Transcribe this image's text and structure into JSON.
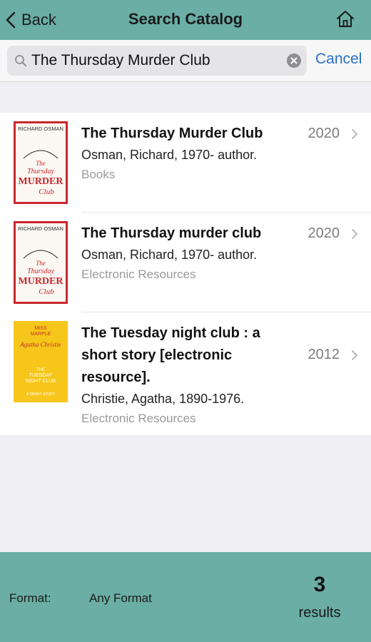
{
  "nav": {
    "back_label": "Back",
    "title": "Search Catalog",
    "home_icon": "home-icon"
  },
  "search": {
    "query": "The Thursday Murder Club",
    "placeholder": "",
    "cancel_label": "Cancel"
  },
  "results": [
    {
      "title": "The Thursday Murder Club",
      "author": "Osman, Richard, 1970- author.",
      "format": "Books",
      "year": "2020",
      "cover": {
        "author_line": "RICHARD OSMAN",
        "title_line1": "The",
        "title_line2": "Thursday",
        "title_line3": "MURDER",
        "title_line4": "Club",
        "bg": "#fbf7f2",
        "accent": "#c8282d"
      }
    },
    {
      "title": "The Thursday murder club",
      "author": "Osman, Richard, 1970- author.",
      "format": "Electronic Resources",
      "year": "2020",
      "cover": {
        "author_line": "RICHARD OSMAN",
        "title_line1": "The",
        "title_line2": "Thursday",
        "title_line3": "MURDER",
        "title_line4": "Club",
        "bg": "#fbf7f2",
        "accent": "#c8282d"
      }
    },
    {
      "title_lines": [
        "The Tuesday night club : a",
        "short story [electronic",
        "resource]."
      ],
      "author": "Christie, Agatha, 1890-1976.",
      "format": "Electronic Resources",
      "year": "2012",
      "cover": {
        "top_line1": "MISS",
        "top_line2": "MARPLE",
        "script_name": "Agatha Christie",
        "title_line1": "THE",
        "title_line2": "TUESDAY",
        "title_line3": "NIGHT CLUB",
        "bottom_line": "A SHORT STORY",
        "bg": "#f6c61a",
        "accent": "#c0322b"
      }
    }
  ],
  "footer": {
    "format_label": "Format:",
    "format_value": "Any Format",
    "count": "3",
    "count_label": "results"
  },
  "colors": {
    "nav_bg": "#6aaea6",
    "link": "#2a6fc4",
    "page_bg": "#efeff4"
  }
}
